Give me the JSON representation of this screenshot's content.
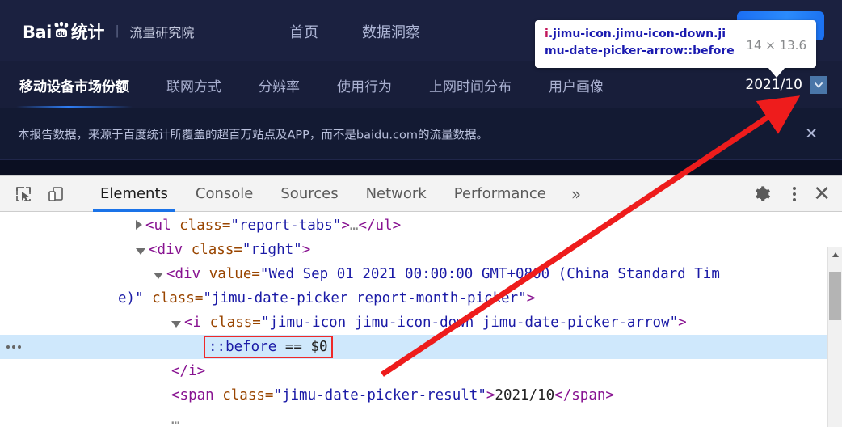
{
  "page": {
    "logo": {
      "brand_prefix": "Bai",
      "brand_suffix": "du",
      "brand_cn": "统计",
      "separator": "|",
      "subtitle": "流量研究院"
    },
    "top_nav": [
      {
        "label": "首页"
      },
      {
        "label": "数据洞察"
      }
    ],
    "tabs": [
      {
        "label": "移动设备市场份额",
        "active": true
      },
      {
        "label": "联网方式",
        "active": false
      },
      {
        "label": "分辨率",
        "active": false
      },
      {
        "label": "使用行为",
        "active": false
      },
      {
        "label": "上网时间分布",
        "active": false
      },
      {
        "label": "用户画像",
        "active": false
      }
    ],
    "date_picker": {
      "value": "2021/10",
      "arrow_icon": "chevron-down-icon"
    },
    "notice": {
      "text": "本报告数据，来源于百度统计所覆盖的超百万站点及APP，而不是baidu.com的流量数据。",
      "close_label": "✕"
    }
  },
  "tooltip": {
    "selector_element": "i",
    "selector_rest": ".jimu-icon.jimu-icon-down.jimu-date-picker-arrow::before",
    "size": "14 × 13.6"
  },
  "devtools": {
    "tabs": [
      {
        "label": "Elements",
        "active": true
      },
      {
        "label": "Console",
        "active": false
      },
      {
        "label": "Sources",
        "active": false
      },
      {
        "label": "Network",
        "active": false
      },
      {
        "label": "Performance",
        "active": false
      }
    ],
    "more_label": "»",
    "close_label": "✕",
    "dom": {
      "row1": {
        "t1": "<ul",
        "t2": " class=",
        "t3": "\"report-tabs\"",
        "t4": ">",
        "t5": "…",
        "t6": "</ul>"
      },
      "row2": {
        "t1": "<div",
        "t2": " class=",
        "t3": "\"right\"",
        "t4": ">"
      },
      "row3": {
        "t1": "<div",
        "t2": " value=",
        "t3": "\"Wed Sep 01 2021 00:00:00 GMT+0800 (China Standard Tim"
      },
      "row4": {
        "t1": "e)\"",
        "t2": " class=",
        "t3": "\"jimu-date-picker report-month-picker\"",
        "t4": ">"
      },
      "row5": {
        "t1": "<i",
        "t2": " class=",
        "t3": "\"jimu-icon jimu-icon-down jimu-date-picker-arrow\"",
        "t4": ">"
      },
      "row6": {
        "pseudo": "::before",
        "eq": " == $0"
      },
      "row7": {
        "t1": "</i>"
      },
      "row8": {
        "t1": "<span",
        "t2": " class=",
        "t3": "\"jimu-date-picker-result\"",
        "t4": ">",
        "t5": "2021/10",
        "t6": "</span>"
      },
      "row9": {
        "t1": "…"
      }
    }
  },
  "colors": {
    "page_header_bg": "#1b2140",
    "page_bg": "#10152b",
    "accent_blue": "#1a73e8",
    "annotation_red": "#ee1c1c",
    "selected_row": "#cfe8fc"
  }
}
